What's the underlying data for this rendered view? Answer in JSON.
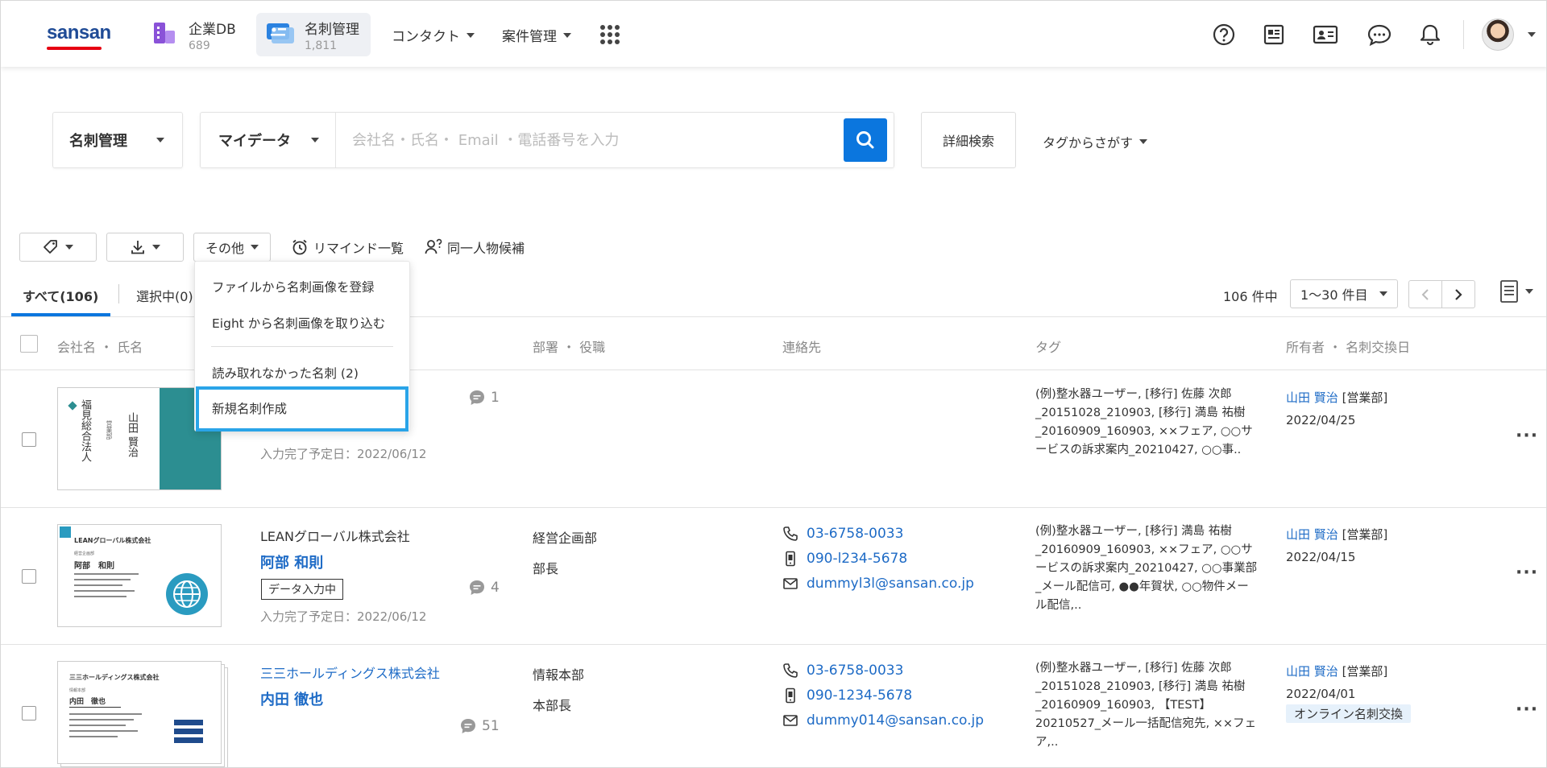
{
  "header": {
    "logo": "sansan",
    "nav": [
      {
        "title": "企業DB",
        "count": "689",
        "icon": "company-db-icon",
        "color": "#8a52d8"
      },
      {
        "title": "名刺管理",
        "count": "1,811",
        "icon": "business-card-icon",
        "color": "#2b82e0"
      }
    ],
    "menus": [
      "コンタクト",
      "案件管理"
    ],
    "icons": [
      "help-icon",
      "news-icon",
      "profile-card-icon",
      "chat-icon",
      "bell-icon"
    ]
  },
  "search": {
    "scope": "名刺管理",
    "data_scope": "マイデータ",
    "placeholder": "会社名・氏名・ Email ・電話番号を入力",
    "advanced": "詳細検索",
    "tag_search": "タグからさがす"
  },
  "toolbar": {
    "other": "その他",
    "remind": "リマインド一覧",
    "same_person": "同一人物候補"
  },
  "dropdown": {
    "items": [
      "ファイルから名刺画像を登録",
      "Eight から名刺画像を取り込む",
      "読み取れなかった名刺 (2)",
      "新規名刺作成"
    ]
  },
  "tabs": {
    "all": "すべて(106)",
    "selected": "選択中(0)"
  },
  "pager": {
    "total": "106 件中",
    "range": "1〜30 件目"
  },
  "columns": [
    "会社名 ・ 氏名",
    "部署 ・ 役職",
    "連絡先",
    "タグ",
    "所有者 ・ 名刺交換日"
  ],
  "rows": [
    {
      "company": "",
      "name": "",
      "status": "",
      "due": "入力完了予定日：2022/06/12",
      "comments": "1",
      "dept": "",
      "title": "",
      "phone": "",
      "mobile": "",
      "email": "",
      "tags": "(例)整水器ユーザー, [移行] 佐藤 次郎_20151028_210903, [移行] 満島 祐樹_20160909_160903, ××フェア, ○○サービスの訴求案内_20210427, ○○事..",
      "owner": "山田 賢治",
      "owner_dept": "[営業部]",
      "date": "2022/04/25",
      "badge": "",
      "card_text": [
        "福見総合法人",
        "営業部",
        "山田 賢治"
      ]
    },
    {
      "company": "LEANグローバル株式会社",
      "name": "阿部 和則",
      "status": "データ入力中",
      "due": "入力完了予定日：2022/06/12",
      "comments": "4",
      "dept": "経営企画部",
      "title": "部長",
      "phone": "03-6758-0033",
      "mobile": "090-l234-5678",
      "email": "dummyl3l@sansan.co.jp",
      "tags": "(例)整水器ユーザー, [移行] 満島 祐樹_20160909_160903, ××フェア, ○○サービスの訴求案内_20210427, ○○事業部_メール配信可, ●●年賀状, ○○物件メール配信,..",
      "owner": "山田 賢治",
      "owner_dept": "[営業部]",
      "date": "2022/04/15",
      "badge": "",
      "card_text": [
        "LEANグローバル株式会社",
        "経営企画部",
        "阿部　和則"
      ]
    },
    {
      "company": "三三ホールディングス株式会社",
      "name": "内田 徹也",
      "status": "",
      "due": "",
      "comments": "51",
      "dept": "情報本部",
      "title": "本部長",
      "phone": "03-6758-0033",
      "mobile": "090-1234-5678",
      "email": "dummy014@sansan.co.jp",
      "tags": "(例)整水器ユーザー, [移行] 佐藤 次郎_20151028_210903, [移行] 満島 祐樹_20160909_160903, 【TEST】20210527_メール一括配信宛先, ××フェア,..",
      "owner": "山田 賢治",
      "owner_dept": "[営業部]",
      "date": "2022/04/01",
      "badge": "オンライン名刺交換",
      "card_text": [
        "三三ホールディングス株式会社",
        "情報本部",
        "内田　徹也"
      ]
    }
  ],
  "colors": {
    "accent": "#0b76de",
    "link": "#1e6bc6",
    "highlight": "#2aa4e8",
    "logo_red": "#e60012",
    "logo_blue": "#1f4b96"
  }
}
